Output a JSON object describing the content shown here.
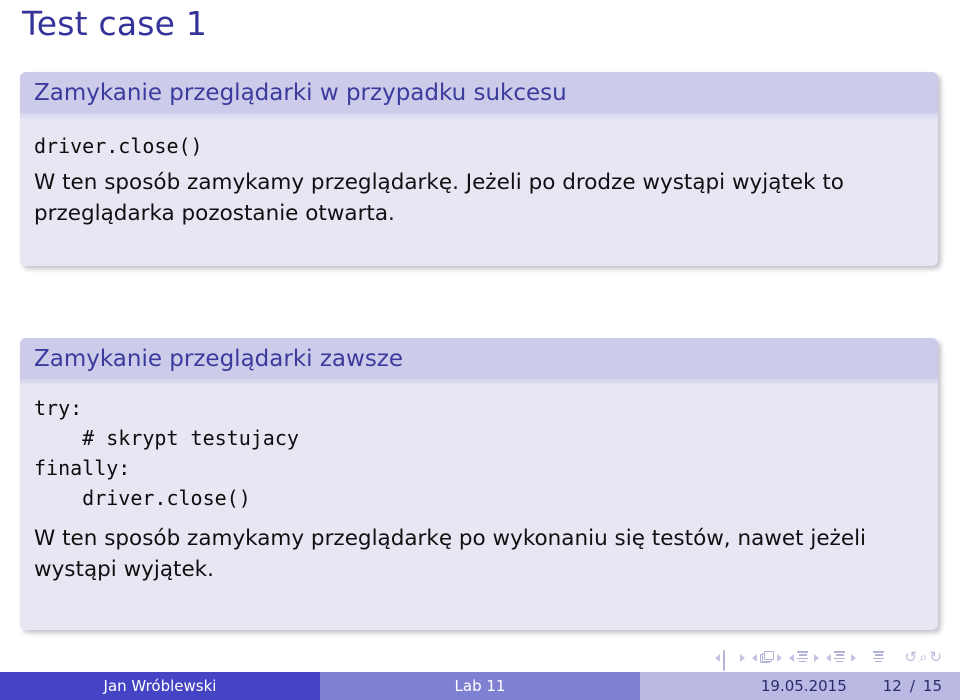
{
  "slide": {
    "frame_title": "Test case 1",
    "title_color": "#33339a"
  },
  "blocks": [
    {
      "name": "success-block",
      "title": "Zamykanie przeglądarki w przypadku sukcesu",
      "code": "driver.close()",
      "paragraph": "W ten sposób zamykamy przeglądarkę. Jeżeli po drodze wystąpi wyjątek to przeglądarka pozostanie otwarta."
    },
    {
      "name": "always-block",
      "title": "Zamykanie przeglądarki zawsze",
      "code_lines": [
        "try:",
        "    # skrypt testujacy",
        "finally:",
        "    driver.close()"
      ],
      "paragraph": "W ten sposób zamykamy przeglądarkę po wykonaniu się testów, nawet jeżeli wystąpi wyjątek."
    }
  ],
  "navigation": {
    "icons": [
      "previous-slide-icon",
      "slide-icon",
      "next-slide-icon",
      "previous-frame-icon",
      "frame-icon",
      "next-frame-icon",
      "previous-subsection-icon",
      "subsection-icon",
      "next-subsection-icon",
      "previous-section-icon",
      "section-icon",
      "next-section-icon",
      "presentation-icon",
      "back-icon",
      "find-icon",
      "forward-icon"
    ],
    "back_glyph": "↺",
    "find_glyph": "⌕",
    "forward_glyph": "↻"
  },
  "footer": {
    "author": "Jan Wróblewski",
    "title": "Lab 11",
    "date": "19.05.2015",
    "current_page": "12",
    "page_separator": "/",
    "total_pages": "15",
    "author_bg": "#4444c4",
    "title_bg": "#8080d2",
    "meta_bg": "#b9b9e4"
  }
}
